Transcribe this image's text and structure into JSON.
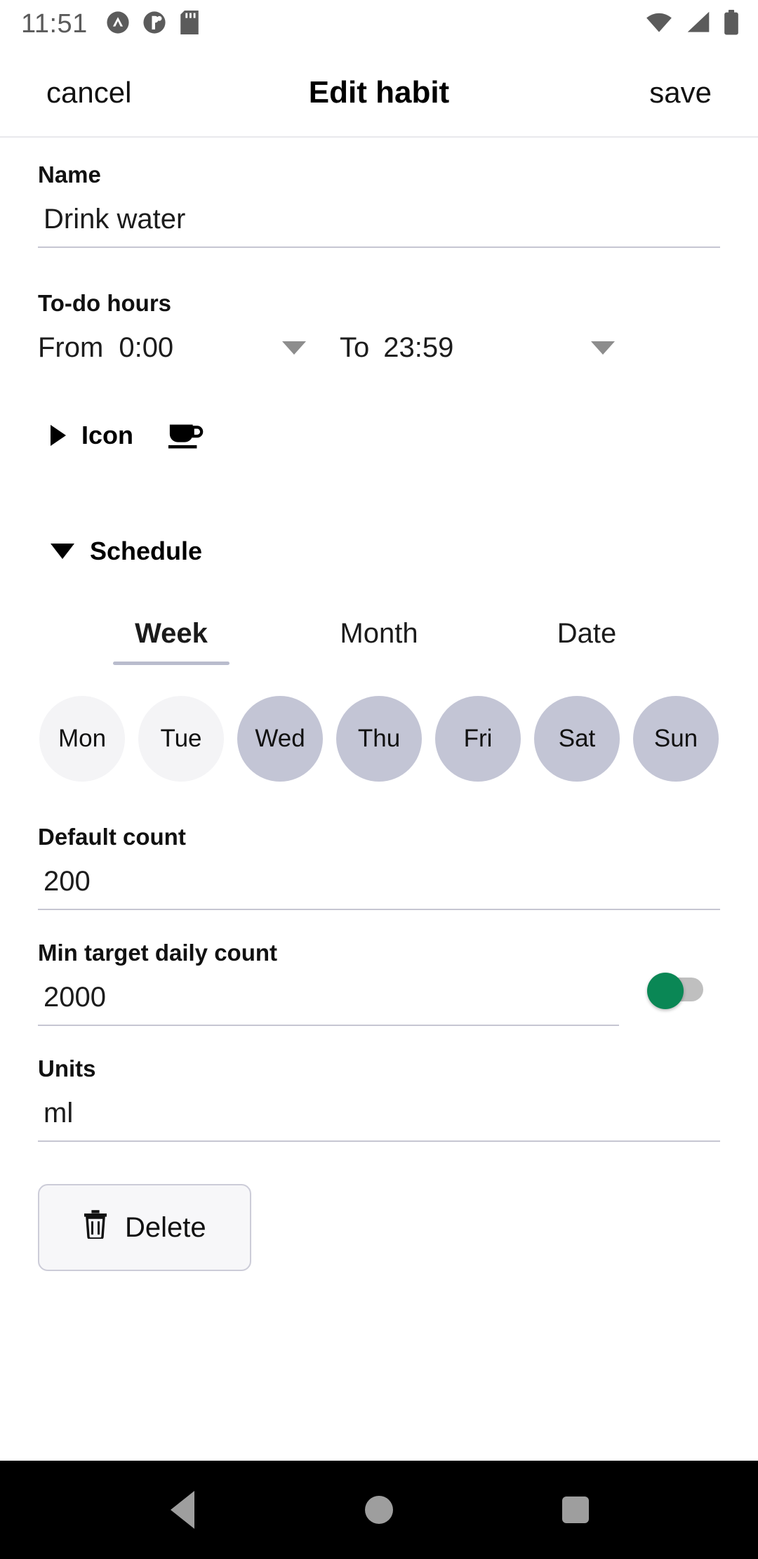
{
  "status_bar": {
    "time": "11:51",
    "left_icons": [
      "chevron-up-badge-icon",
      "notification-dot-icon",
      "sd-card-icon"
    ],
    "right_icons": [
      "wifi-icon",
      "cellular-signal-icon",
      "battery-icon"
    ]
  },
  "app_bar": {
    "cancel_label": "cancel",
    "title": "Edit habit",
    "save_label": "save"
  },
  "form": {
    "name": {
      "label": "Name",
      "value": "Drink water",
      "placeholder": "Name"
    },
    "todo_hours": {
      "label": "To-do hours",
      "from_prefix": "From",
      "from_value": "0:00",
      "to_prefix": "To",
      "to_value": "23:59"
    },
    "icon_section": {
      "label": "Icon",
      "expanded": false,
      "chevron": "triangle-right-icon",
      "selected_icon": "coffee-cup-icon"
    },
    "schedule_section": {
      "label": "Schedule",
      "expanded": true,
      "chevron": "triangle-down-icon",
      "tabs": [
        {
          "label": "Week",
          "active": true
        },
        {
          "label": "Month",
          "active": false
        },
        {
          "label": "Date",
          "active": false
        }
      ],
      "days": [
        {
          "label": "Mon",
          "selected": false
        },
        {
          "label": "Tue",
          "selected": false
        },
        {
          "label": "Wed",
          "selected": true
        },
        {
          "label": "Thu",
          "selected": true
        },
        {
          "label": "Fri",
          "selected": true
        },
        {
          "label": "Sat",
          "selected": true
        },
        {
          "label": "Sun",
          "selected": true
        }
      ]
    },
    "default_count": {
      "label": "Default count",
      "value": "200"
    },
    "min_target_daily_count": {
      "label": "Min target daily count",
      "value": "2000",
      "toggle_on": true
    },
    "units": {
      "label": "Units",
      "value": "ml"
    }
  },
  "delete_button": {
    "label": "Delete",
    "icon": "trash-icon"
  },
  "nav_bar": {
    "back": "back-triangle-icon",
    "home": "home-circle-icon",
    "recents": "recents-square-icon"
  },
  "colors": {
    "accent_green": "#0a8755",
    "day_selected": "#c3c5d5",
    "day_unselected": "#f4f4f6",
    "underline": "#c6c6d2",
    "nav_icon": "#9e9e9e"
  }
}
